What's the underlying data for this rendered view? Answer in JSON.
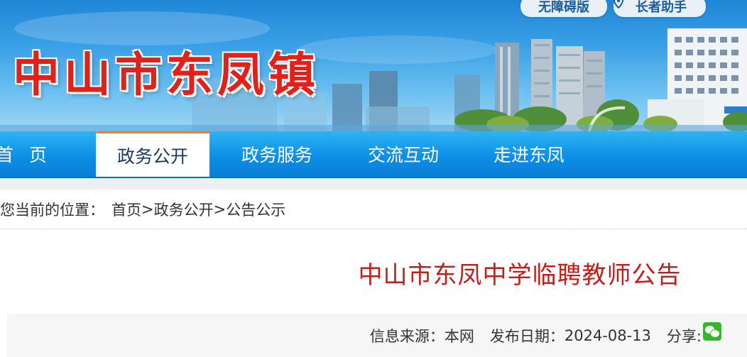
{
  "header": {
    "site_title": "中山市东凤镇",
    "accessibility_label": "无障碍版",
    "elder_label": "长者助手",
    "elder_icon": "location-pin-icon"
  },
  "nav": {
    "items": [
      {
        "label": "首页"
      },
      {
        "label": "政务公开",
        "active": true
      },
      {
        "label": "政务服务"
      },
      {
        "label": "交流互动"
      },
      {
        "label": "走进东凤"
      }
    ]
  },
  "breadcrumb": {
    "prefix": "您当前的位置：",
    "home": "首页",
    "sep1": ">",
    "section": "政务公开",
    "sep2": " >",
    "current": "公告公示"
  },
  "article": {
    "title": "中山市东凤中学临聘教师公告",
    "source_label": "信息来源：",
    "source_value": "本网",
    "date_label": "发布日期：",
    "date_value": "2024-08-13",
    "share_label": "分享:",
    "share_icon": "wechat-icon"
  },
  "colors": {
    "title_red": "#c0201a",
    "nav_blue": "#0d8fe6",
    "active_tab_accent": "#ff7a1c",
    "wechat_green": "#35b72c"
  }
}
